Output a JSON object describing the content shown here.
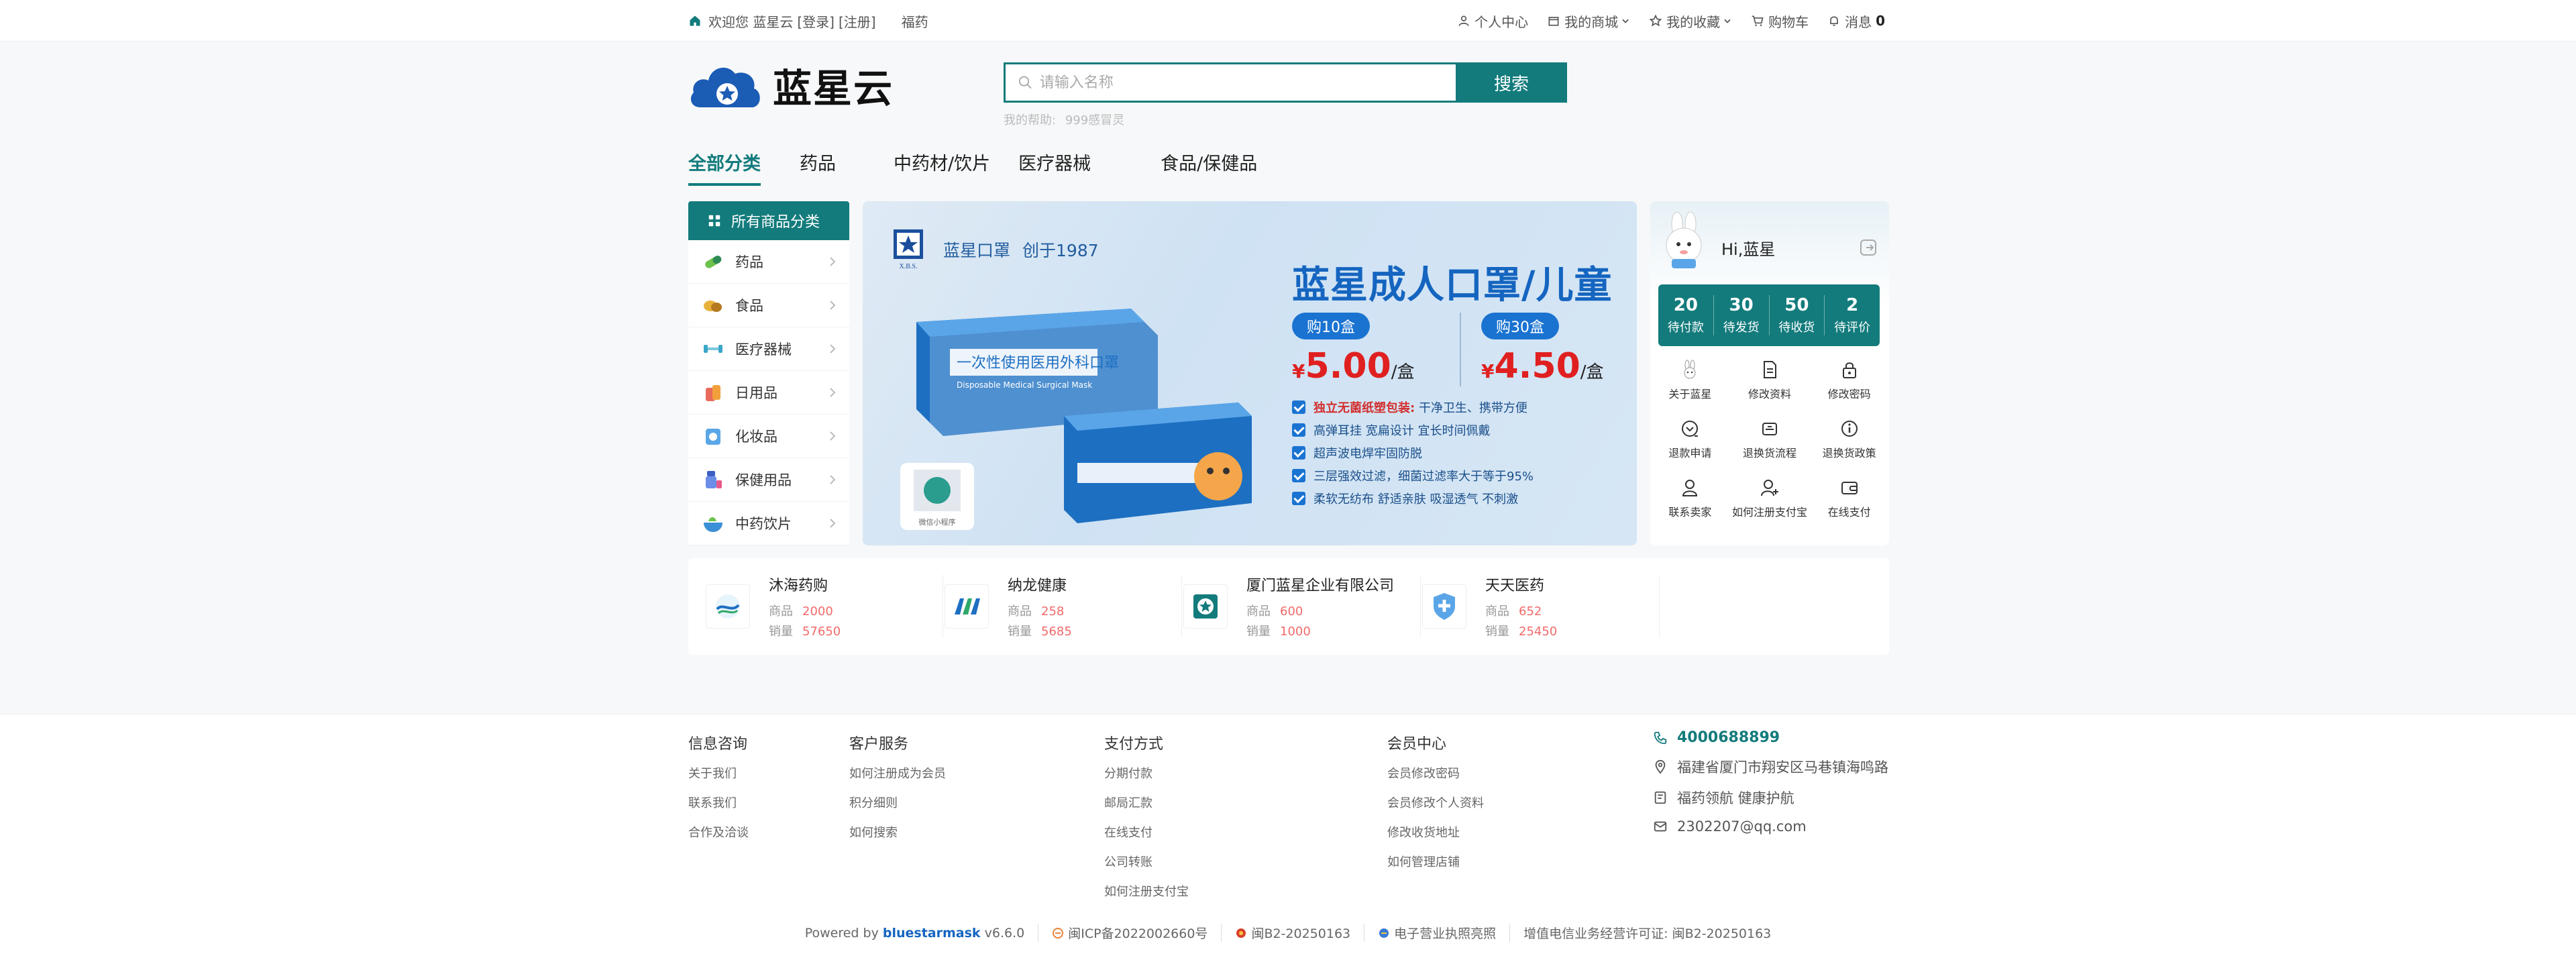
{
  "topbar": {
    "welcome": "欢迎您 蓝星云",
    "login": "[登录]",
    "register": "[注册]",
    "fuyao": "福药",
    "personal": "个人中心",
    "mall": "我的商城",
    "favorites": "我的收藏",
    "cart": "购物车",
    "messages": "消息",
    "message_count": "0"
  },
  "header": {
    "logo_text": "蓝星云",
    "search_placeholder": "请输入名称",
    "search_button": "搜索",
    "hint_label": "我的帮助:",
    "hint_value": "999感冒灵"
  },
  "nav": {
    "tabs": [
      "全部分类",
      "药品",
      "中药材/饮片",
      "医疗器械",
      "食品/保健品"
    ]
  },
  "categories": {
    "title": "所有商品分类",
    "items": [
      "药品",
      "食品",
      "医疗器械",
      "日用品",
      "化妆品",
      "保健用品",
      "中药饮片"
    ]
  },
  "banner": {
    "brand_name": "蓝星口罩",
    "brand_since": "创于1987",
    "headline": "蓝星成人口罩/儿童",
    "deal1_label": "购10盒",
    "deal1_currency": "¥",
    "deal1_price": "5.00",
    "deal1_unit": "/盒",
    "deal2_label": "购30盒",
    "deal2_currency": "¥",
    "deal2_price": "4.50",
    "deal2_unit": "/盒",
    "feature1_red": "独立无菌纸塑包装:",
    "feature1_rest": "干净卫生、携带方便",
    "feature2": "高弹耳挂 宽扁设计 宜长时间佩戴",
    "feature3": "超声波电焊牢固防脱",
    "feature4": "三层强效过滤，细菌过滤率大于等于95%",
    "feature5": "柔软无纺布 舒适亲肤 吸湿透气 不刺激",
    "box_text": "一次性使用医用外科口罩",
    "box_sub": "Disposable Medical Surgical Mask",
    "qr_label": "微信小程序",
    "seal_label": "X.B.S."
  },
  "user": {
    "greeting": "Hi,蓝星",
    "stats": [
      {
        "num": "20",
        "label": "待付款"
      },
      {
        "num": "30",
        "label": "待发货"
      },
      {
        "num": "50",
        "label": "待收货"
      },
      {
        "num": "2",
        "label": "待评价"
      }
    ],
    "links": [
      "关于蓝星",
      "修改资料",
      "修改密码",
      "退款申请",
      "退换货流程",
      "退换货政策",
      "联系卖家",
      "如何注册支付宝",
      "在线支付"
    ]
  },
  "shops": [
    {
      "name": "沐海药购",
      "goods_label": "商品",
      "goods": "2000",
      "sales_label": "销量",
      "sales": "57650"
    },
    {
      "name": "纳龙健康",
      "goods_label": "商品",
      "goods": "258",
      "sales_label": "销量",
      "sales": "5685"
    },
    {
      "name": "厦门蓝星企业有限公司",
      "goods_label": "商品",
      "goods": "600",
      "sales_label": "销量",
      "sales": "1000"
    },
    {
      "name": "天天医药",
      "goods_label": "商品",
      "goods": "652",
      "sales_label": "销量",
      "sales": "25450"
    }
  ],
  "footer": {
    "cols": [
      {
        "title": "信息咨询",
        "links": [
          "关于我们",
          "联系我们",
          "合作及洽谈"
        ]
      },
      {
        "title": "客户服务",
        "links": [
          "如何注册成为会员",
          "积分细则",
          "如何搜索"
        ]
      },
      {
        "title": "支付方式",
        "links": [
          "分期付款",
          "邮局汇款",
          "在线支付",
          "公司转账",
          "如何注册支付宝"
        ]
      },
      {
        "title": "会员中心",
        "links": [
          "会员修改密码",
          "会员修改个人资料",
          "修改收货地址",
          "如何管理店铺"
        ]
      }
    ],
    "phone": "4000688899",
    "address": "福建省厦门市翔安区马巷镇海鸣路",
    "slogan": "福药领航 健康护航",
    "email": "2302207@qq.com",
    "powered_prefix": "Powered by",
    "powered_brand": "bluestarmask",
    "powered_version": "v6.6.0",
    "icp": "闽ICP备2022002660号",
    "b2": "闽B2-20250163",
    "license": "电子营业执照亮照",
    "telecom": "增值电信业务经营许可证: 闽B2-20250163"
  },
  "colors": {
    "primary": "#137b7c",
    "banner_blue": "#1565c0",
    "price_red": "#e02020"
  }
}
